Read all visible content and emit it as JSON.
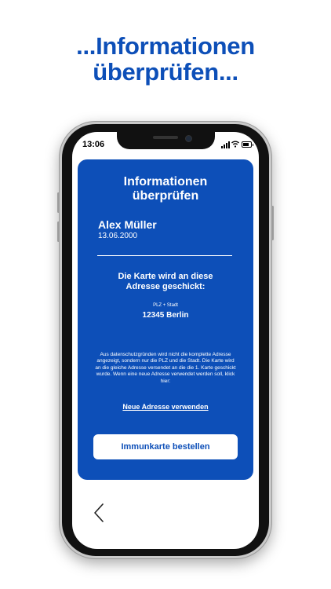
{
  "headline": {
    "line1": "...Informationen",
    "line2": "überprüfen..."
  },
  "status_bar": {
    "time": "13:06"
  },
  "card": {
    "title_line1": "Informationen",
    "title_line2": "überprüfen",
    "name": "Alex Müller",
    "dob": "13.06.2000",
    "address_heading_line1": "Die Karte wird an diese",
    "address_heading_line2": "Adresse geschickt:",
    "plz_label": "PLZ + Stadt",
    "city": "12345 Berlin",
    "privacy_text": "Aus datenschutzgründen wird nicht die komplette Adresse angezeigt, sondern nur die PLZ und die Stadt. Die Karte wird an die gleiche Adresse versendet an die die 1. Karte geschickt wurde. Wenn eine neue Adresse verwendet werden soll, klick hier:",
    "new_address_link": "Neue Adresse verwenden",
    "order_button": "Immunkarte bestellen"
  },
  "colors": {
    "brand_blue": "#0d4fb8",
    "white": "#ffffff"
  },
  "icons": {
    "back": "chevron-left-icon",
    "wifi": "wifi-icon",
    "signal": "signal-icon",
    "battery": "battery-icon"
  }
}
